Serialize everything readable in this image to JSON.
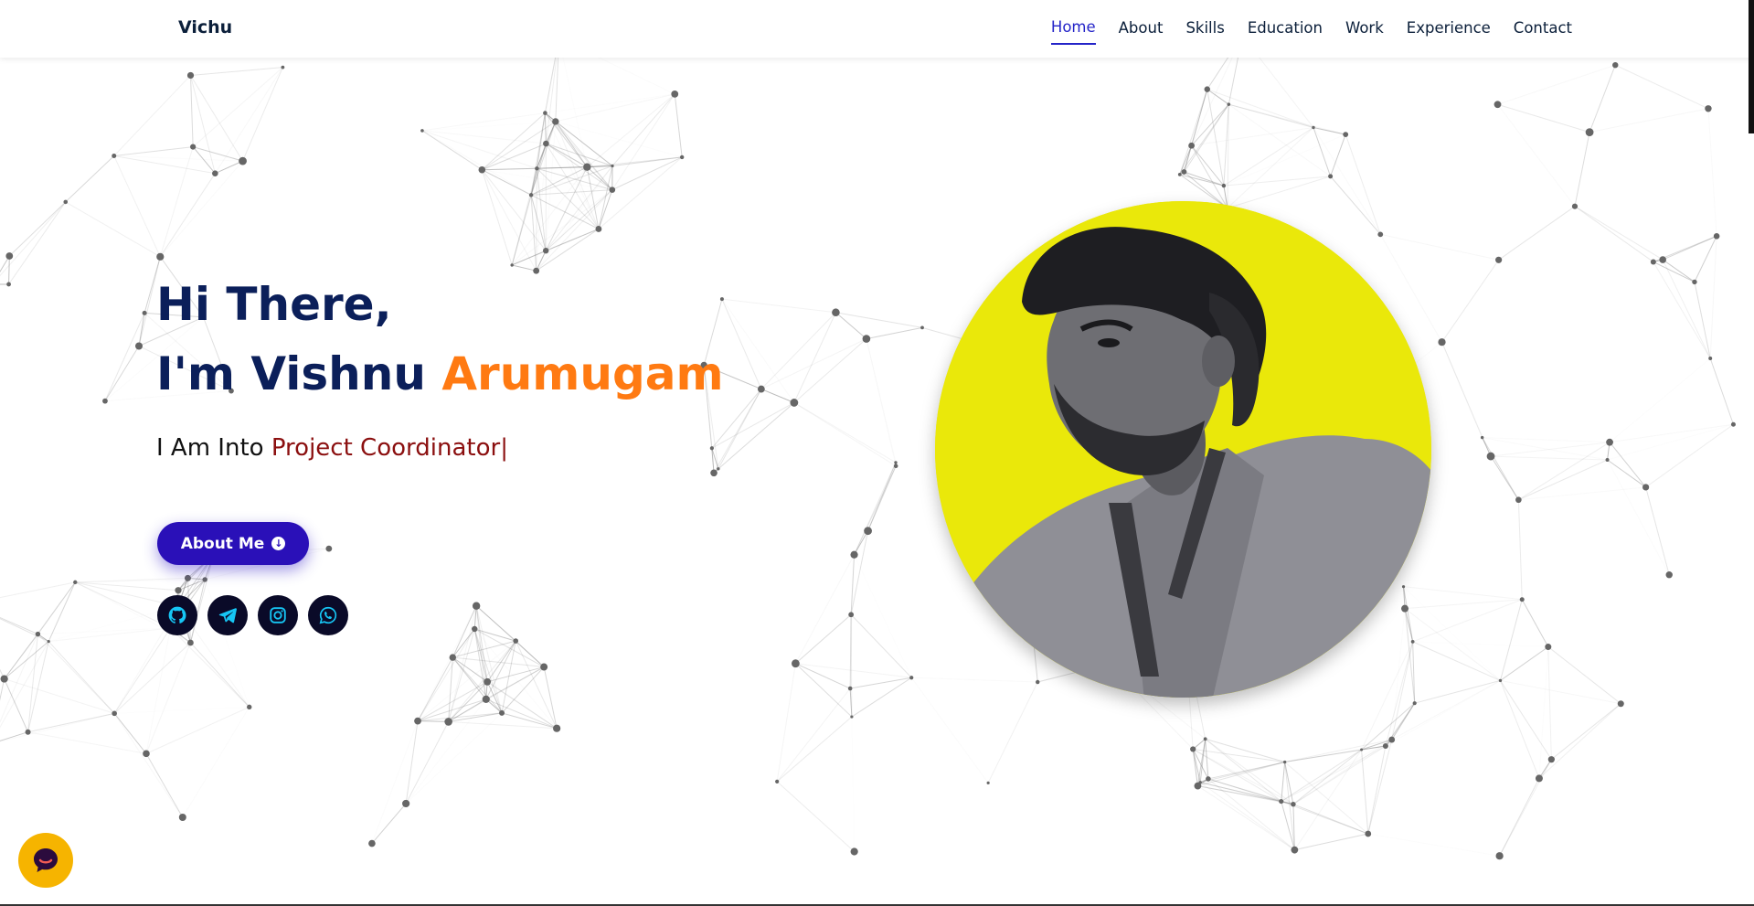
{
  "brand": "Vichu",
  "nav": {
    "items": [
      {
        "label": "Home",
        "active": true
      },
      {
        "label": "About"
      },
      {
        "label": "Skills"
      },
      {
        "label": "Education"
      },
      {
        "label": "Work"
      },
      {
        "label": "Experience"
      },
      {
        "label": "Contact"
      }
    ]
  },
  "hero": {
    "greeting": "Hi There,",
    "intro_prefix": "I'm Vishnu",
    "intro_highlight": "Arumugam",
    "typing_prefix": "I Am Into",
    "typing_role": "Project Coordinator",
    "typing_cursor": "|",
    "about_button": "About Me"
  },
  "socials": [
    {
      "icon": "github-icon"
    },
    {
      "icon": "telegram-icon"
    },
    {
      "icon": "instagram-icon"
    },
    {
      "icon": "whatsapp-icon"
    }
  ],
  "colors": {
    "heading": "#0b1f5a",
    "accent_orange": "#ff7a12",
    "role_red": "#8b0f0f",
    "button": "#2a10b8",
    "nav_active": "#2424c8",
    "photo_bg": "#eae80a",
    "social_bg": "#0a0a28",
    "social_icon": "#16c6f5",
    "chat_bubble": "#f6b400"
  },
  "chat_widget": {
    "icon": "chat-icon"
  }
}
